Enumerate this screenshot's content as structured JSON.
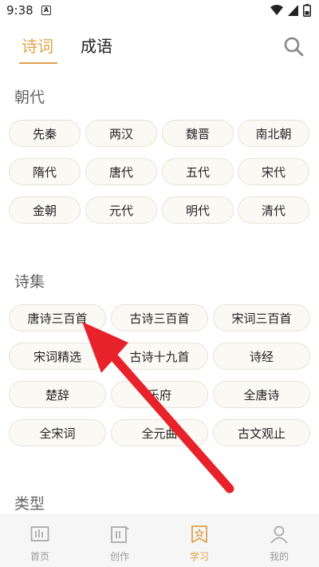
{
  "status": {
    "time": "9:38",
    "notif_glyph": "A"
  },
  "tabs": [
    {
      "label": "诗词"
    },
    {
      "label": "成语"
    }
  ],
  "sections": {
    "dynasty": {
      "title": "朝代",
      "items": [
        "先秦",
        "两汉",
        "魏晋",
        "南北朝",
        "隋代",
        "唐代",
        "五代",
        "宋代",
        "金朝",
        "元代",
        "明代",
        "清代"
      ]
    },
    "collection": {
      "title": "诗集",
      "items": [
        "唐诗三百首",
        "古诗三百首",
        "宋词三百首",
        "宋词精选",
        "古诗十九首",
        "诗经",
        "楚辞",
        "乐府",
        "全唐诗",
        "全宋词",
        "全元曲",
        "古文观止"
      ]
    },
    "type": {
      "title": "类型"
    }
  },
  "bottom_nav": [
    {
      "label": "首页",
      "icon": "home-icon"
    },
    {
      "label": "创作",
      "icon": "create-icon"
    },
    {
      "label": "学习",
      "icon": "study-icon"
    },
    {
      "label": "我的",
      "icon": "profile-icon"
    }
  ],
  "colors": {
    "accent": "#e0a24a",
    "annotation_arrow": "#e8222a"
  }
}
